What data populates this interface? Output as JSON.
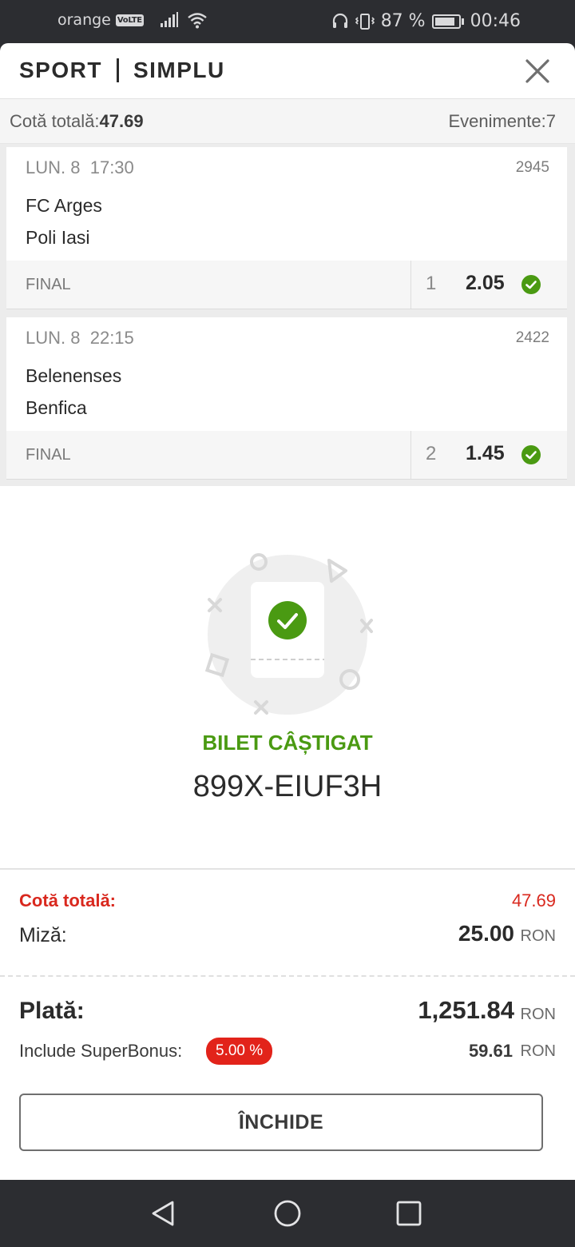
{
  "status_bar": {
    "carrier": "orange",
    "volte": "VoLTE",
    "battery": "87 %",
    "battery_level": 0.87,
    "time": "00:46"
  },
  "header": {
    "sport_label": "SPORT",
    "mode_label": "SIMPLU"
  },
  "summary": {
    "total_odds_label": "Cotă totală:",
    "total_odds_value": "47.69",
    "events_label": "Evenimente:",
    "events_value": "7"
  },
  "events": [
    {
      "date": "LUN. 8",
      "time": "17:30",
      "code": "2945",
      "home": "FC Arges",
      "away": "Poli Iasi",
      "market": "FINAL",
      "selection": "1",
      "odd": "2.05",
      "status": "won"
    },
    {
      "date": "LUN. 8",
      "time": "22:15",
      "code": "2422",
      "home": "Belenenses",
      "away": "Benfica",
      "market": "FINAL",
      "selection": "2",
      "odd": "1.45",
      "status": "won"
    }
  ],
  "result": {
    "status": "BILET CÂȘTIGAT",
    "ticket_id": "899X-EIUF3H"
  },
  "totals": {
    "odds_label": "Cotă totală:",
    "odds_value": "47.69",
    "stake_label": "Miză:",
    "stake_value": "25.00",
    "currency": "RON"
  },
  "payout": {
    "label": "Plată:",
    "value": "1,251.84",
    "currency": "RON",
    "bonus_label": "Include SuperBonus:",
    "bonus_percent": "5.00 %",
    "bonus_value": "59.61",
    "bonus_currency": "RON"
  },
  "actions": {
    "close_label": "ÎNCHIDE"
  },
  "colors": {
    "accent_red": "#d9281e",
    "win_green": "#4a9a12",
    "badge_red": "#e2231a"
  },
  "icons": {
    "close": "close-icon",
    "check": "check-circle-icon",
    "nav_back": "triangle-back-icon",
    "nav_home": "circle-home-icon",
    "nav_recents": "square-recents-icon"
  }
}
